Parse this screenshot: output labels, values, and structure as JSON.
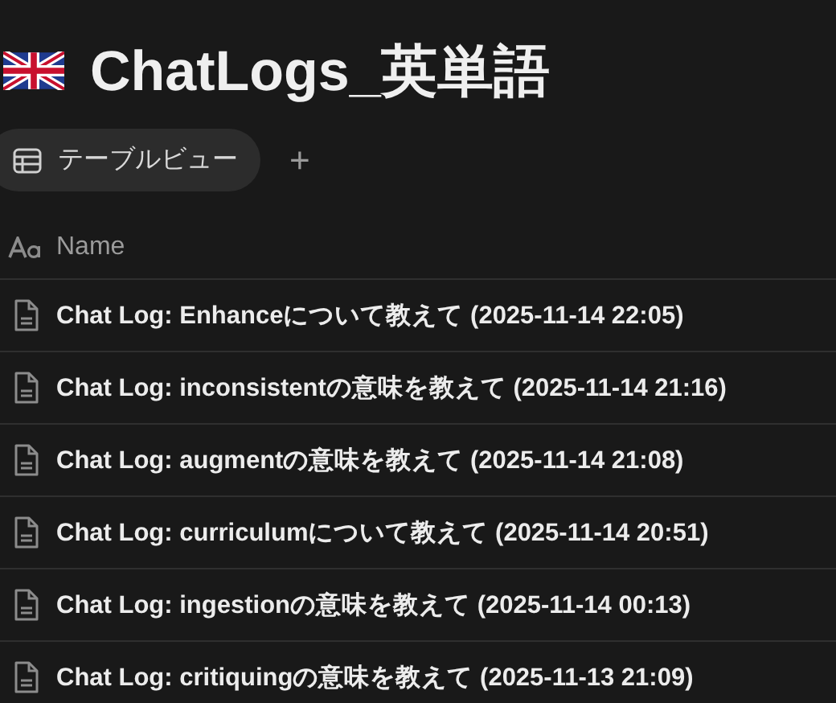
{
  "page": {
    "title": "ChatLogs_英単語"
  },
  "views": [
    {
      "label": "テーブルビュー",
      "selected": true
    }
  ],
  "add_view": "+",
  "table": {
    "columns": [
      {
        "label": "Name"
      }
    ],
    "rows": [
      {
        "name": "Chat Log: Enhanceについて教えて (2025-11-14 22:05)"
      },
      {
        "name": "Chat Log: inconsistentの意味を教えて (2025-11-14 21:16)"
      },
      {
        "name": "Chat Log: augmentの意味を教えて (2025-11-14 21:08)"
      },
      {
        "name": "Chat Log: curriculumについて教えて (2025-11-14 20:51)"
      },
      {
        "name": "Chat Log: ingestionの意味を教えて (2025-11-14 00:13)"
      },
      {
        "name": "Chat Log: critiquingの意味を教えて (2025-11-13 21:09)"
      }
    ]
  }
}
